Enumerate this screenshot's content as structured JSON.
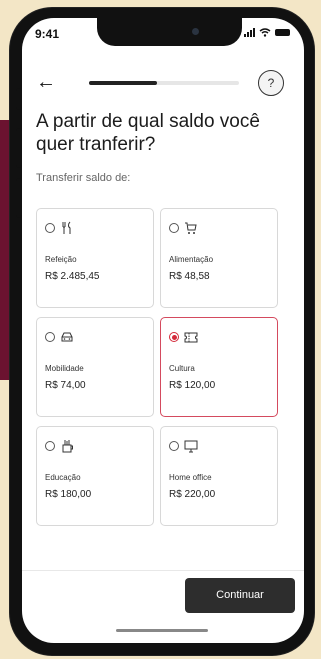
{
  "status_bar": {
    "time": "9:41"
  },
  "header": {
    "progress": 0.45,
    "help_label": "?"
  },
  "title": "A partir de qual saldo você quer tranferir?",
  "subtitle": "Transferir saldo de:",
  "cards": [
    {
      "name": "Refeição",
      "amount": "R$ 2.485,45",
      "icon": "cutlery-icon",
      "selected": false
    },
    {
      "name": "Alimentação",
      "amount": "R$ 48,58",
      "icon": "shopping-cart-icon",
      "selected": false
    },
    {
      "name": "Mobilidade",
      "amount": "R$ 74,00",
      "icon": "car-icon",
      "selected": false
    },
    {
      "name": "Cultura",
      "amount": "R$ 120,00",
      "icon": "ticket-icon",
      "selected": true
    },
    {
      "name": "Educação",
      "amount": "R$ 180,00",
      "icon": "pencil-cup-icon",
      "selected": false
    },
    {
      "name": "Home office",
      "amount": "R$ 220,00",
      "icon": "monitor-icon",
      "selected": false
    }
  ],
  "continue_label": "Continuar",
  "colors": {
    "accent": "#d42a3a",
    "button": "#2d2d2d",
    "background": "#f3e6c6",
    "brand": "#6b1230"
  }
}
